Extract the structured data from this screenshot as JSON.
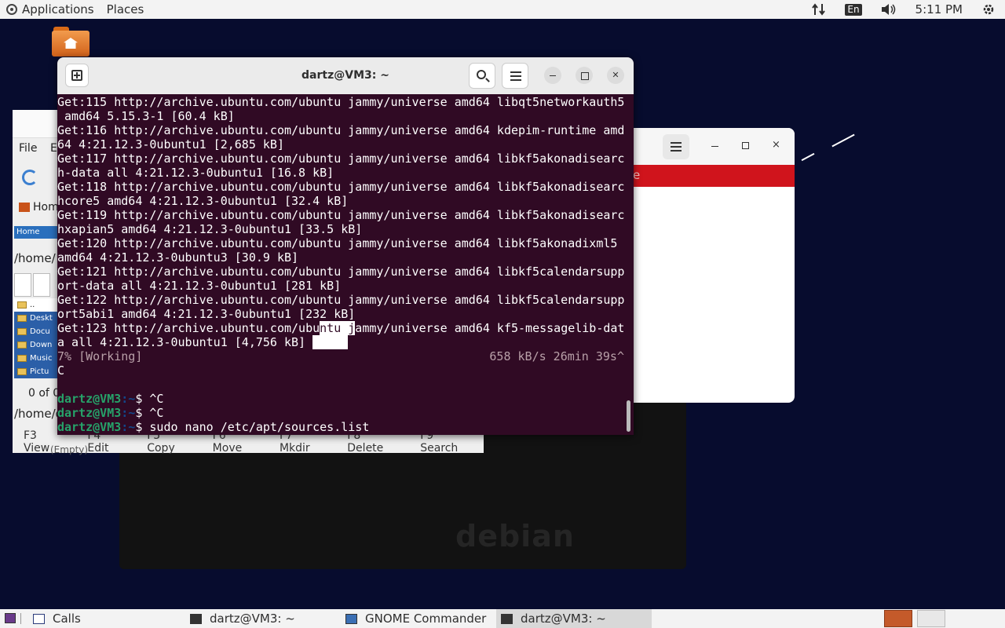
{
  "top_panel": {
    "applications": "Applications",
    "places": "Places",
    "network_icon": "network-updown-icon",
    "keyboard_layout": "En",
    "volume_icon": "volume-icon",
    "clock": "5:11 PM",
    "system_icon": "gear-icon"
  },
  "terminal": {
    "title": "dartz@VM3: ~",
    "lines": [
      "Get:115 http://archive.ubuntu.com/ubuntu jammy/universe amd64 libqt5networkauth5",
      " amd64 5.15.3-1 [60.4 kB]",
      "Get:116 http://archive.ubuntu.com/ubuntu jammy/universe amd64 kdepim-runtime amd",
      "64 4:21.12.3-0ubuntu1 [2,685 kB]",
      "Get:117 http://archive.ubuntu.com/ubuntu jammy/universe amd64 libkf5akonadisearc",
      "h-data all 4:21.12.3-0ubuntu1 [16.8 kB]",
      "Get:118 http://archive.ubuntu.com/ubuntu jammy/universe amd64 libkf5akonadisearc",
      "hcore5 amd64 4:21.12.3-0ubuntu1 [32.4 kB]",
      "Get:119 http://archive.ubuntu.com/ubuntu jammy/universe amd64 libkf5akonadisearc",
      "hxapian5 amd64 4:21.12.3-0ubuntu1 [33.5 kB]",
      "Get:120 http://archive.ubuntu.com/ubuntu jammy/universe amd64 libkf5akonadixml5",
      "amd64 4:21.12.3-0ubuntu3 [30.9 kB]",
      "Get:121 http://archive.ubuntu.com/ubuntu jammy/universe amd64 libkf5calendarsupp",
      "ort-data all 4:21.12.3-0ubuntu1 [281 kB]",
      "Get:122 http://archive.ubuntu.com/ubuntu jammy/universe amd64 libkf5calendarsupp",
      "ort5abi1 amd64 4:21.12.3-0ubuntu1 [232 kB]"
    ],
    "line_123a_pre": "Get:123 http://archive.ubuntu.com/ubu",
    "line_123a_hl": "ntu j",
    "line_123a_post": "ammy/universe amd64 kf5-messagelib-dat",
    "line_123b_pre": "a all 4:21.12.3-0ubuntu1 [4,756 kB] ",
    "line_123b_hl": "     ",
    "progress": "7% [Working]",
    "speed": "658 kB/s 26min 39s^",
    "ctrl_c": "C",
    "prompt_user": "dartz@VM3",
    "prompt_path": ":~",
    "prompt_symbol": "$",
    "commands": [
      "^C",
      "^C",
      "sudo nano /etc/apt/sources.list",
      ""
    ]
  },
  "gnome_commander": {
    "menu_file": "File",
    "menu_edit": "E",
    "home_label": "Hom",
    "tab_label": "Home",
    "path": "/home/",
    "folders": [
      "..",
      "Deskt",
      "Docu",
      "Down",
      "Music",
      "Pictu"
    ],
    "count": "0 of 0",
    "path2": "/home/d",
    "fkeys": [
      "F3 View",
      "F4 Edit",
      "F5 Copy",
      "F6 Move",
      "F7 Mkdir",
      "F8 Delete",
      "F9 Search"
    ],
    "empty": "(Empty)"
  },
  "debian_window": {
    "close": "×",
    "logo_text": "debian"
  },
  "white_window": {
    "close": "×",
    "red_char": "e"
  },
  "taskbar": {
    "items": [
      {
        "label": "Calls",
        "icon": "calls-icon"
      },
      {
        "label": "dartz@VM3: ~",
        "icon": "terminal-icon"
      },
      {
        "label": "GNOME Commander",
        "icon": "gnome-commander-icon"
      },
      {
        "label": "dartz@VM3: ~",
        "icon": "terminal-icon"
      }
    ]
  }
}
